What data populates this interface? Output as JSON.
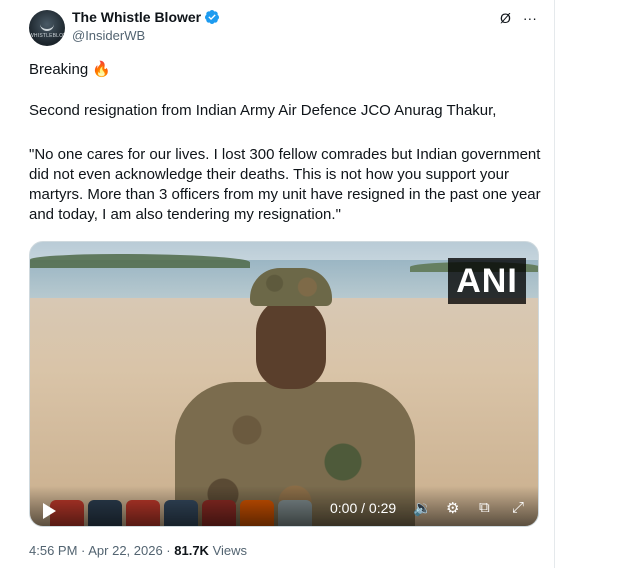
{
  "author": {
    "name": "The Whistle Blower",
    "handle": "@InsiderWB",
    "avatar_text": "WHISTLEBLOWER"
  },
  "header_icons": {
    "grok": "Ø",
    "more": "···"
  },
  "tweet": {
    "breaking": "Breaking 🔥",
    "line2": "Second resignation from Indian Army Air Defence JCO Anurag Thakur,",
    "quote": "\"No one cares for our lives. I lost 300 fellow comrades but Indian government did not even acknowledge their deaths. This is not how you support your martyrs. More than 3 officers from my unit have resigned in the past one year and today, I am also tendering my resignation.\""
  },
  "video": {
    "watermark": "ANI",
    "time": "0:00 / 0:29",
    "icons": {
      "play": "play-icon",
      "volume": "🔉",
      "settings": "⚙",
      "pip": "⧉",
      "fullscreen": "⤢"
    }
  },
  "footer": {
    "timestamp": "4:56 PM · Apr 22, 2026 · ",
    "views_count": "81.7K",
    "views_label": " Views"
  },
  "colors": {
    "text": "#0f1419",
    "secondary": "#536471",
    "verified": "#1d9bf0",
    "border": "#cfd9de"
  }
}
